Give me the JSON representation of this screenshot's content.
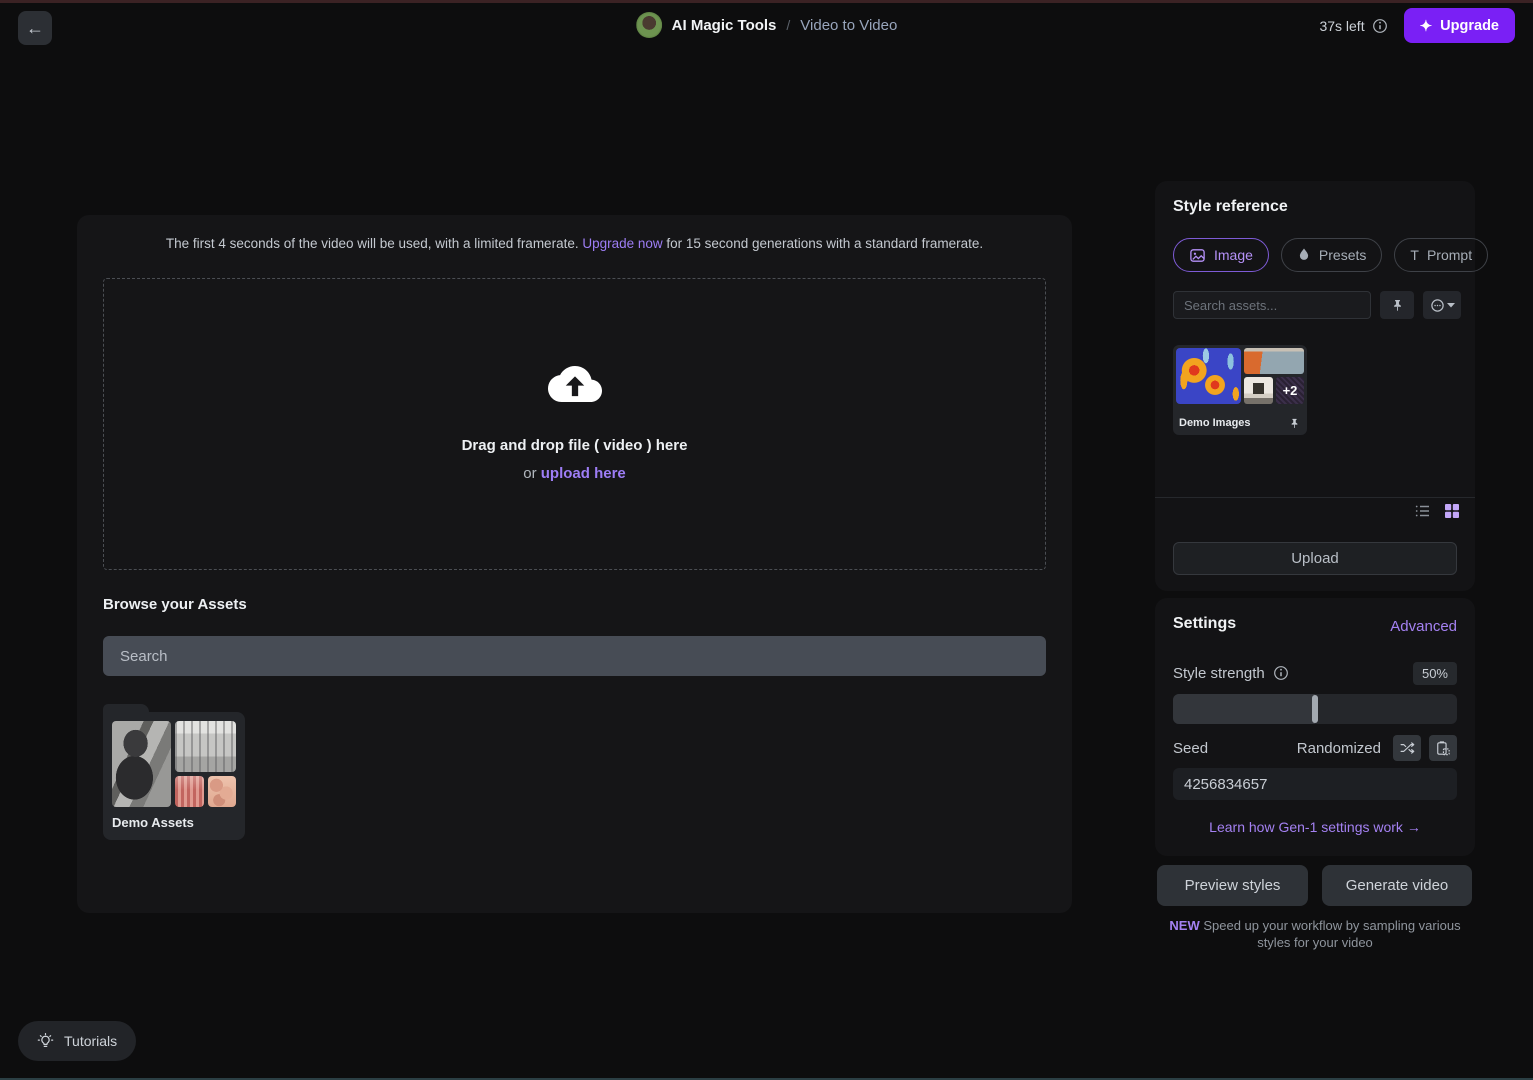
{
  "header": {
    "back_icon": "←",
    "app_title": "AI Magic Tools",
    "separator": "/",
    "page_title": "Video to Video",
    "credits_left": "37s left",
    "upgrade": {
      "icon": "✦",
      "label": "Upgrade"
    }
  },
  "main": {
    "notice": {
      "before": "The first 4 seconds of the video will be used, with a limited framerate. ",
      "link": "Upgrade now",
      "after": " for 15 second generations with a standard framerate."
    },
    "dropzone": {
      "title": "Drag and drop file ( video ) here",
      "or_prefix": "or ",
      "upload_link": "upload here"
    },
    "assets": {
      "heading": "Browse your Assets",
      "search_placeholder": "Search",
      "folders": [
        {
          "label": "Demo Assets"
        }
      ]
    }
  },
  "style_reference": {
    "title": "Style reference",
    "tabs": [
      {
        "label": "Image"
      },
      {
        "label": "Presets"
      },
      {
        "label": "Prompt"
      }
    ],
    "prompt_tab_glyph": "T",
    "search_placeholder": "Search assets...",
    "folders": [
      {
        "label": "Demo Images",
        "extra_count": "+2"
      }
    ],
    "upload_label": "Upload"
  },
  "settings": {
    "title": "Settings",
    "advanced": "Advanced",
    "style_strength": {
      "label": "Style strength",
      "value": "50%"
    },
    "seed": {
      "label": "Seed",
      "mode": "Randomized",
      "value": "4256834657"
    },
    "learn_link": "Learn how Gen-1 settings work",
    "arrow": "→"
  },
  "actions": {
    "preview": "Preview styles",
    "generate": "Generate video",
    "badge": "NEW",
    "note": " Speed up your workflow by sampling various styles for your video"
  },
  "footer": {
    "tutorials": "Tutorials"
  },
  "colors": {
    "accent_purple": "#a481f2",
    "upgrade_purple": "#7a20f5",
    "tab_selected_purple": "#b591f8",
    "panel_bg": "#131315",
    "page_bg": "#0d0d0e"
  }
}
